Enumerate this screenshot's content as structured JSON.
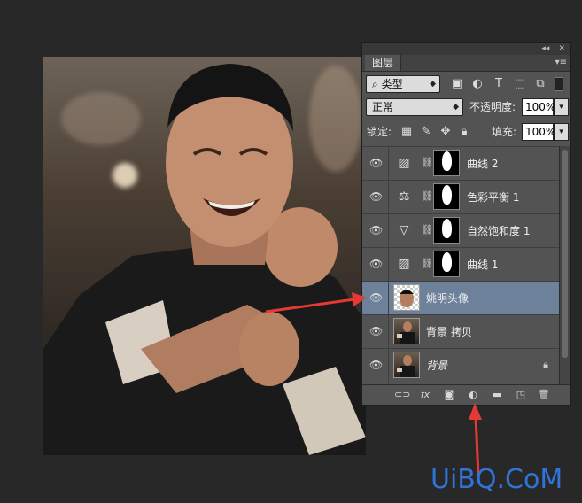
{
  "panel": {
    "tab_label": "图层",
    "collapse_glyph": "◂◂",
    "close_glyph": "✕",
    "menu_glyph": "▾≡",
    "filter": {
      "kind_value": "类型"
    },
    "blend": {
      "mode_value": "正常",
      "opacity_label": "不透明度:",
      "opacity_value": "100%"
    },
    "lock": {
      "label": "锁定:",
      "fill_label": "填充:",
      "fill_value": "100%"
    },
    "layers": [
      {
        "name": "曲线 2",
        "type": "adjustment",
        "icon": "curves-icon",
        "selected": false
      },
      {
        "name": "色彩平衡 1",
        "type": "adjustment",
        "icon": "balance-icon",
        "selected": false
      },
      {
        "name": "自然饱和度 1",
        "type": "adjustment",
        "icon": "vibrance-icon",
        "selected": false
      },
      {
        "name": "曲线 1",
        "type": "adjustment",
        "icon": "curves-icon",
        "selected": false
      },
      {
        "name": "姚明头像",
        "type": "pixel",
        "selected": true
      },
      {
        "name": "背景 拷贝",
        "type": "pixel",
        "selected": false
      },
      {
        "name": "背景",
        "type": "background",
        "selected": false
      }
    ]
  },
  "colors": {
    "panel_bg": "#535353",
    "selected_layer": "#6d819b",
    "arrow": "#e53935",
    "watermark": "#2f74d6"
  },
  "watermark": "UiBQ.CoM"
}
